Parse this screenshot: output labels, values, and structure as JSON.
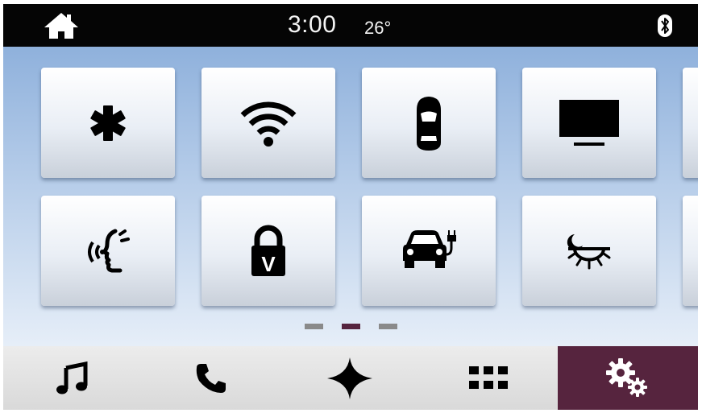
{
  "status_bar": {
    "time": "3:00",
    "temperature": "26°",
    "home_icon": "home-icon",
    "bluetooth_icon": "bluetooth-icon"
  },
  "tiles": [
    {
      "icon": "asterisk-icon",
      "row": 1
    },
    {
      "icon": "wifi-icon",
      "row": 1
    },
    {
      "icon": "car-top-view-icon",
      "row": 1
    },
    {
      "icon": "display-icon",
      "row": 1
    },
    {
      "icon": "voice-command-icon",
      "row": 2
    },
    {
      "icon": "valet-lock-icon",
      "row": 2
    },
    {
      "icon": "electric-car-charging-icon",
      "row": 2
    },
    {
      "icon": "ambient-light-icon",
      "row": 2
    }
  ],
  "page_indicator": {
    "pages": 3,
    "active": 2
  },
  "bottom_nav": [
    {
      "icon": "music-note-icon",
      "active": false
    },
    {
      "icon": "phone-icon",
      "active": false
    },
    {
      "icon": "navigation-star-icon",
      "active": false
    },
    {
      "icon": "apps-grid-icon",
      "active": false
    },
    {
      "icon": "settings-gears-icon",
      "active": true
    }
  ],
  "colors": {
    "status_bar_bg": "#050505",
    "content_gradient_top": "#8fb1dc",
    "content_gradient_bottom": "#e6eef8",
    "active_nav_bg": "#56243e",
    "dot_inactive": "#8a8a8a",
    "dot_active": "#56243e"
  }
}
